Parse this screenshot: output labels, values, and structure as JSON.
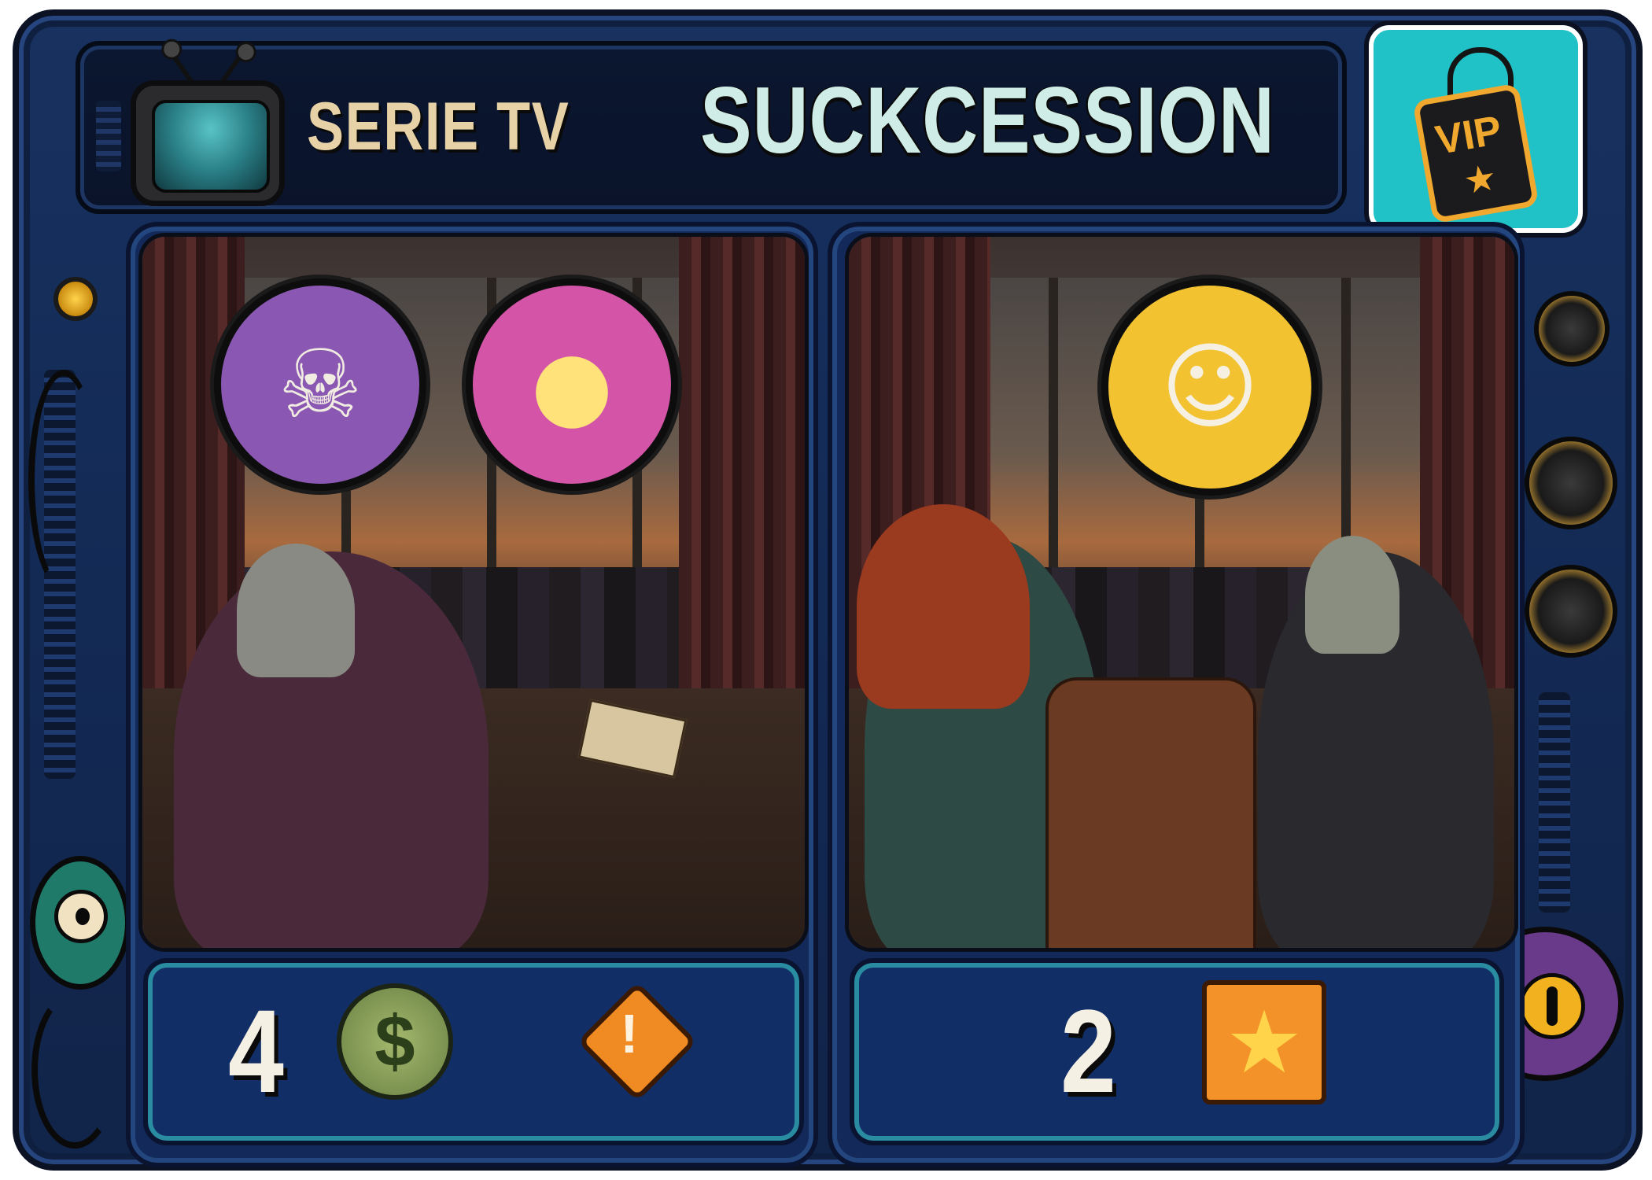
{
  "card": {
    "category": "SERIE TV",
    "title": "SUCKCESSION",
    "vip_label": "VIP"
  },
  "left_panel": {
    "traits": [
      "skull-icon",
      "spotlight-icon"
    ],
    "cost_value": "4",
    "cost_icon": "dollar-coin-icon",
    "coin_symbol": "$",
    "effect_icon": "alert-burst-icon",
    "effect_symbol": "!"
  },
  "right_panel": {
    "traits": [
      "comedy-mask-icon"
    ],
    "reward_value": "2",
    "reward_icon": "star-icon"
  },
  "colors": {
    "frame": "#132a55",
    "vip_box": "#20c2c7",
    "title_text": "#cfece6",
    "category_text": "#e7d1a6",
    "skull_badge": "#8a58b3",
    "spotlight_badge": "#d455a8",
    "mask_badge": "#f2c231",
    "coin": "#7a9150",
    "alert": "#f08a23",
    "star_box": "#f39229"
  }
}
